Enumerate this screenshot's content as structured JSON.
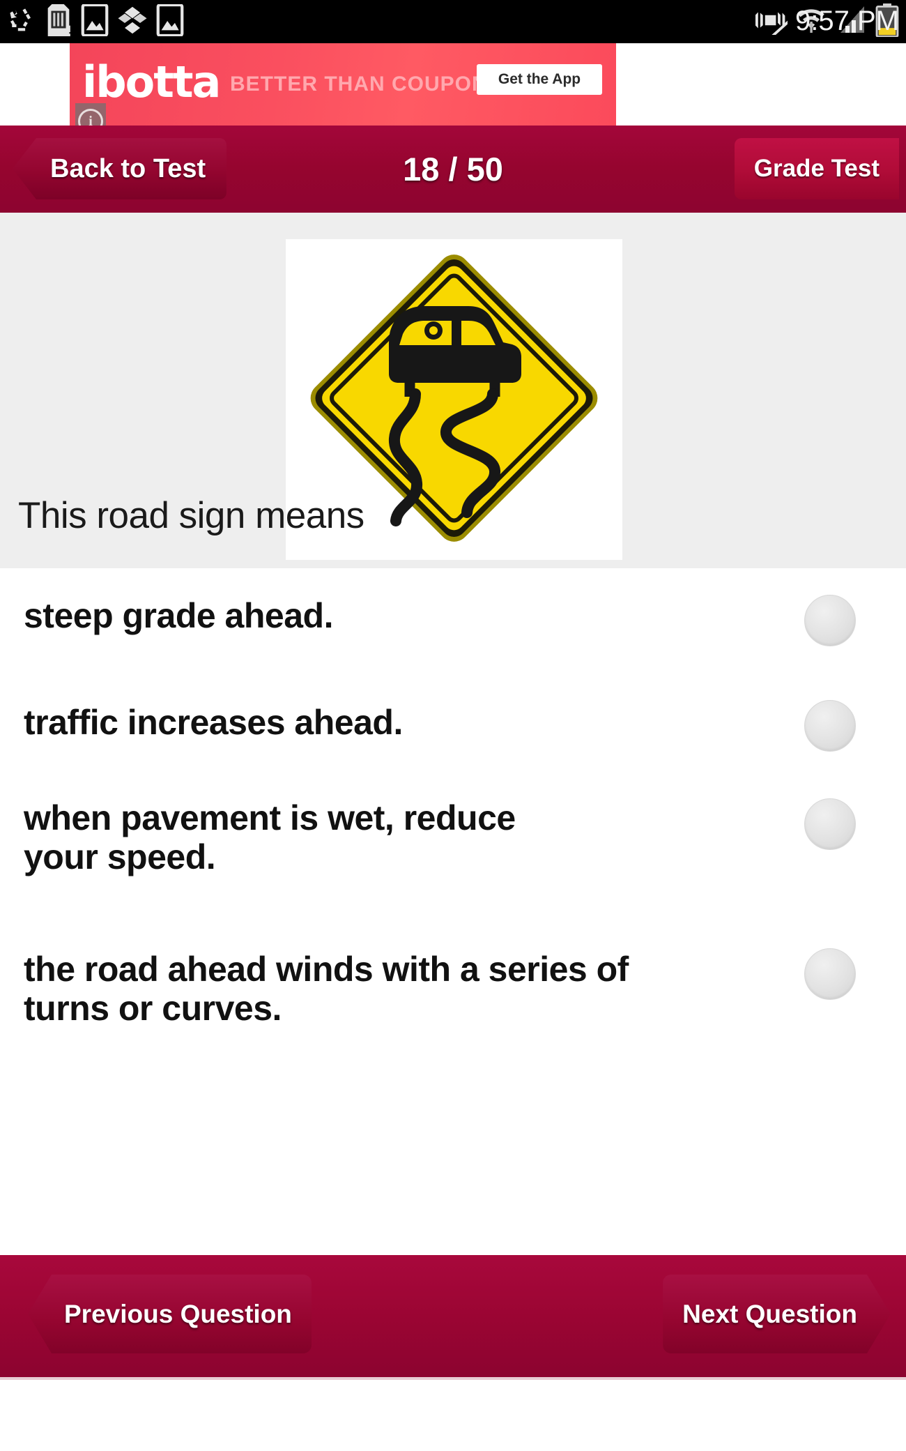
{
  "status_bar": {
    "time": "9:57 PM",
    "left_icons": [
      "recycle-icon",
      "sd-card-alert-icon",
      "screenshot-image-icon",
      "dropbox-icon",
      "gallery-image-icon"
    ],
    "right_icons": [
      "vibrate-off-icon",
      "wifi-icon",
      "cellular-signal-icon",
      "battery-icon"
    ],
    "battery_color": "#f2d024"
  },
  "ad": {
    "brand": "ibotta",
    "tagline": "BETTER THAN COUPONS",
    "cta_label": "Get the App",
    "info_glyph": "i",
    "background_color": "#fa4f5f"
  },
  "header": {
    "back_label": "Back to Test",
    "counter": "18 / 50",
    "grade_label": "Grade Test",
    "background_color": "#96052f"
  },
  "question": {
    "prompt": "This road sign means",
    "sign": {
      "name": "slippery-when-wet-sign",
      "shape": "diamond",
      "fill_color": "#f8d800",
      "border_color": "#1a1a08"
    }
  },
  "answers": {
    "options": [
      {
        "label": "steep grade ahead.",
        "selected": false
      },
      {
        "label": "traffic increases ahead.",
        "selected": false
      },
      {
        "label": "when pavement is wet, reduce your speed.",
        "selected": false
      },
      {
        "label": "the road ahead winds with a series of turns or curves.",
        "selected": false
      }
    ],
    "radio_color": "#e2e2e2"
  },
  "footer": {
    "previous_label": "Previous Question",
    "next_label": "Next Question",
    "background_color": "#9b0533"
  }
}
